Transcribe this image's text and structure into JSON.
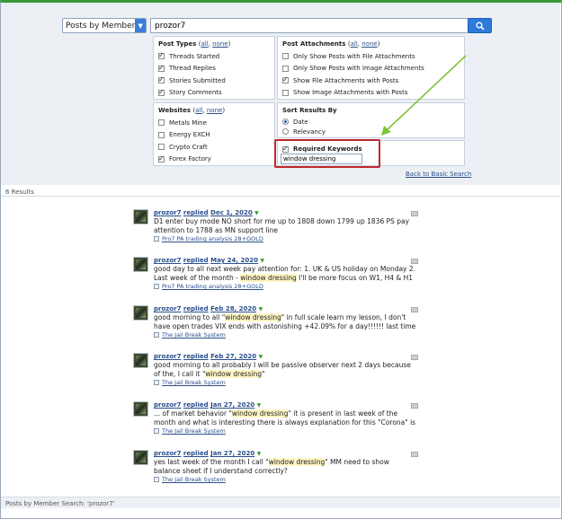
{
  "search": {
    "scope_label": "Posts by Member",
    "query": "prozor7"
  },
  "post_types": {
    "title": "Post Types",
    "all": "all",
    "none": "none",
    "options": [
      {
        "label": "Threads Started",
        "checked": true
      },
      {
        "label": "Thread Replies",
        "checked": true
      },
      {
        "label": "Stories Submitted",
        "checked": true
      },
      {
        "label": "Story Comments",
        "checked": true
      }
    ]
  },
  "post_attachments": {
    "title": "Post Attachments",
    "all": "all",
    "none": "none",
    "options": [
      {
        "label": "Only Show Posts with File Attachments",
        "checked": false
      },
      {
        "label": "Only Show Posts with Image Attachments",
        "checked": false
      },
      {
        "label": "Show File Attachments with Posts",
        "checked": true
      },
      {
        "label": "Show Image Attachments with Posts",
        "checked": false
      }
    ]
  },
  "websites": {
    "title": "Websites",
    "all": "all",
    "none": "none",
    "options": [
      {
        "label": "Metals Mine",
        "checked": false
      },
      {
        "label": "Energy EXCH",
        "checked": false
      },
      {
        "label": "Crypto Craft",
        "checked": false
      },
      {
        "label": "Forex Factory",
        "checked": true
      }
    ]
  },
  "sort": {
    "title": "Sort Results By",
    "options": [
      {
        "label": "Date",
        "selected": true
      },
      {
        "label": "Relevancy",
        "selected": false
      }
    ]
  },
  "keywords": {
    "label": "Required Keywords",
    "checked": true,
    "value": "window dressing"
  },
  "back_link": "Back to Basic Search",
  "results_count": "6 Results",
  "results": [
    {
      "user": "prozor7",
      "action": "replied",
      "date": "Dec 1, 2020",
      "text_before": "D1 enter buy mode NO short for me up to 1808 down 1799 up 1836 PS pay attention to 1788 as MN support line",
      "highlight": "",
      "text_after": "",
      "thread": "Pro7 PA trading analysis 28+GOLD"
    },
    {
      "user": "prozor7",
      "action": "replied",
      "date": "May 24, 2020",
      "text_before": "good day to all next week pay attention for: 1. UK & US holiday on Monday 2. Last week of the month - ",
      "highlight": "window dressing",
      "text_after": " I'll be more focus on W1, H4 & H1 chart",
      "thread": "Pro7 PA trading analysis 28+GOLD"
    },
    {
      "user": "prozor7",
      "action": "replied",
      "date": "Feb 28, 2020",
      "text_before": "good morning to all \"",
      "highlight": "window dressing",
      "text_after": "\" in full scale learn my lesson, I don't have open trades VIX ends with astonishing +42.09% for a day!!!!!! last time I saw VIX",
      "thread": "The Jail Break System"
    },
    {
      "user": "prozor7",
      "action": "replied",
      "date": "Feb 27, 2020",
      "text_before": "good morning to all probably I will be passive observer next 2 days because of the, I call it \"",
      "highlight": "window dressing",
      "text_after": "\"",
      "thread": "The Jail Break System"
    },
    {
      "user": "prozor7",
      "action": "replied",
      "date": "Jan 27, 2020",
      "text_before": "... of market behavior \"",
      "highlight": "window dressing",
      "text_after": "\" it is present in last week of the month and what is interesting there is always explanation for this \"Corona\" is today. how",
      "thread": "The Jail Break System"
    },
    {
      "user": "prozor7",
      "action": "replied",
      "date": "Jan 27, 2020",
      "text_before": "yes last week of the month I call \"",
      "highlight": "window dressing",
      "text_after": "\" MM need to show balance sheet if I understand correctly?",
      "thread": "The Jail Break System"
    }
  ],
  "footer": "Posts by Member Search: 'prozor7'",
  "colors": {
    "accent": "#2f7ad9",
    "highlight_box": "#c0282d",
    "annotation_arrow": "#7cc43a"
  }
}
